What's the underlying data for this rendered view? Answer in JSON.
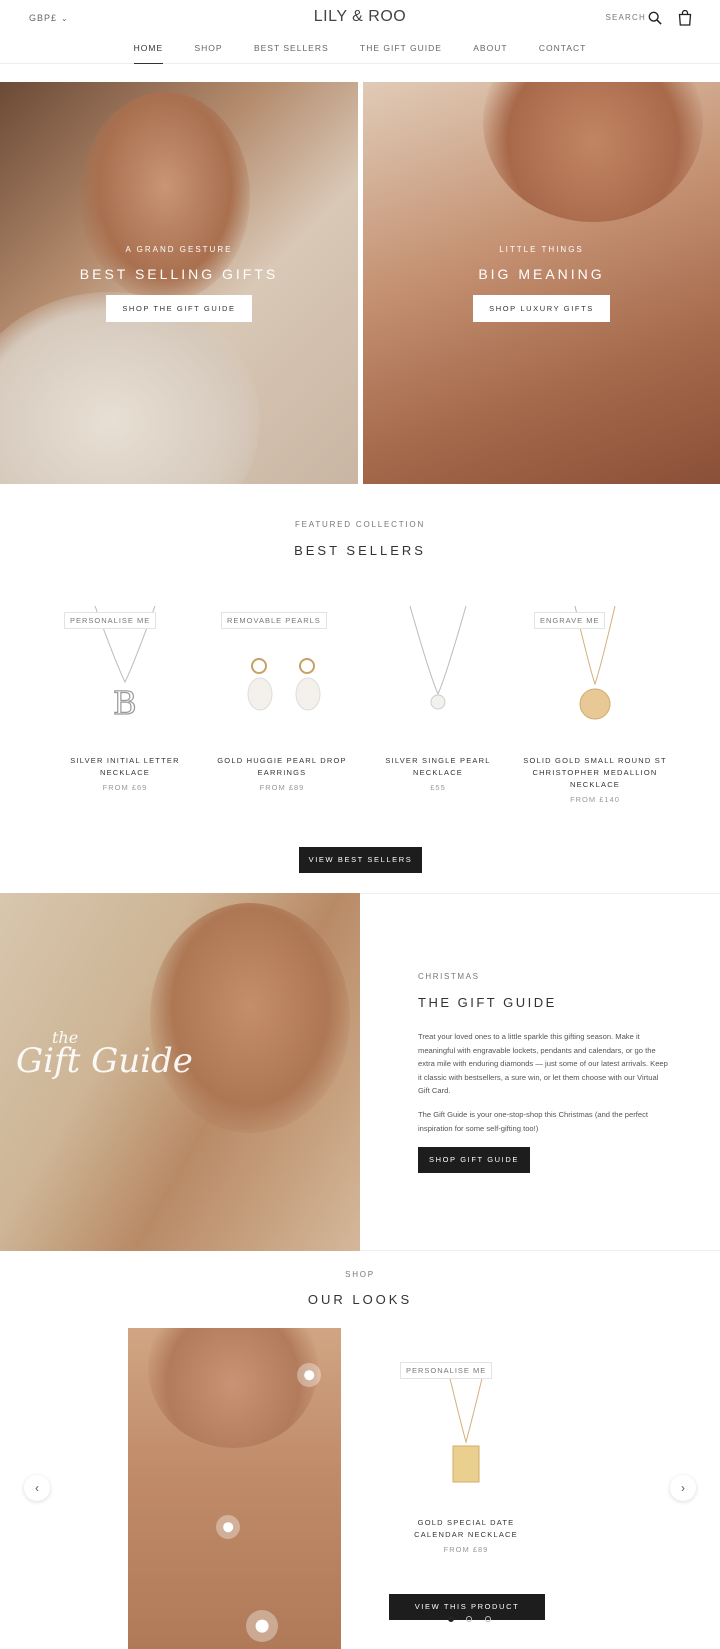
{
  "header": {
    "currency": "GBP£",
    "logo": "LILY & ROO",
    "search_label": "SEARCH",
    "nav": [
      "HOME",
      "SHOP",
      "BEST SELLERS",
      "THE GIFT GUIDE",
      "ABOUT",
      "CONTACT"
    ]
  },
  "hero": {
    "left": {
      "eyebrow": "A GRAND GESTURE",
      "title": "BEST SELLING GIFTS",
      "button": "SHOP THE GIFT GUIDE"
    },
    "right": {
      "eyebrow": "LITTLE THINGS",
      "title": "BIG MEANING",
      "button": "SHOP LUXURY GIFTS"
    }
  },
  "featured": {
    "eyebrow": "FEATURED COLLECTION",
    "title": "BEST SELLERS",
    "products": [
      {
        "badge": "PERSONALISE ME",
        "name": "SILVER INITIAL LETTER NECKLACE",
        "price": "FROM £69"
      },
      {
        "badge": "REMOVABLE PEARLS",
        "name": "GOLD HUGGIE PEARL DROP EARRINGS",
        "price": "FROM £89"
      },
      {
        "badge": "",
        "name": "SILVER SINGLE PEARL NECKLACE",
        "price": "£55"
      },
      {
        "badge": "ENGRAVE ME",
        "name": "SOLID GOLD SMALL ROUND ST CHRISTOPHER MEDALLION NECKLACE",
        "price": "FROM £140"
      }
    ],
    "button": "VIEW BEST SELLERS"
  },
  "gift_guide": {
    "script_small": "the",
    "script_large": "Gift Guide",
    "eyebrow": "CHRISTMAS",
    "title": "THE GIFT GUIDE",
    "paragraph1": "Treat your loved ones to a little sparkle this gifting season. Make it meaningful with engravable lockets, pendants and calendars, or go the extra mile with enduring diamonds — just some of our latest arrivals. Keep it classic with bestsellers, a sure win, or let them choose with our Virtual Gift Card.",
    "paragraph2": "The Gift Guide is your one-stop-shop this Christmas (and the perfect inspiration for some self-gifting too!)",
    "button": "SHOP GIFT GUIDE"
  },
  "looks": {
    "eyebrow": "SHOP",
    "title": "OUR LOOKS",
    "product": {
      "badge": "PERSONALISE ME",
      "name": "GOLD SPECIAL DATE CALENDAR NECKLACE",
      "price": "FROM £89"
    },
    "button": "VIEW THIS PRODUCT",
    "prev": "‹",
    "next": "›"
  },
  "colors": {
    "button_dark": "#1d1d1d",
    "text": "#333333",
    "muted": "#999999"
  }
}
